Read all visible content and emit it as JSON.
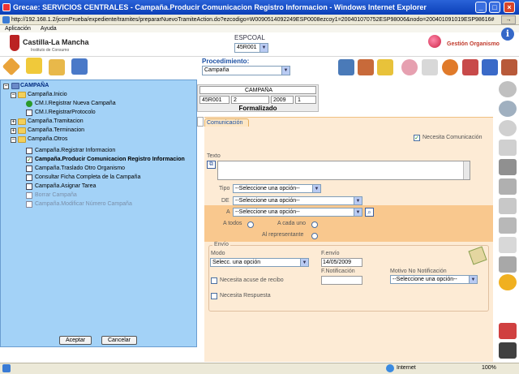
{
  "window": {
    "title": "Grecae: SERVICIOS CENTRALES - Campaña.Producir Comunicacion Registro Informacion - Windows Internet Explorer",
    "url": "http://192.168.1.2/jccmPrueba/expediente/tramites/prepararNuevoTramiteAction.do?ezcodigo=W0090514092249ESP0008ezcoy1=200401070752ESP98006&nodo=200401091019ESP98616#"
  },
  "menu": {
    "items": [
      "Aplicación",
      "Ayuda"
    ]
  },
  "header": {
    "logo": "Castilla-La Mancha",
    "logo_sub": "Instituto de Consumo",
    "espcoal_label": "ESPCOAL",
    "espcoal_value": "45R001",
    "gestion": "Gestión Organismo",
    "procedimiento_label": "Procedimiento:",
    "procedimiento_value": "Campaña"
  },
  "card": {
    "title": "CAMPAÑA",
    "c1": "45R001",
    "c2": "2",
    "c3": "2009",
    "c4": "1",
    "status": "Formalizado"
  },
  "form": {
    "tab": "Comunicación",
    "necesita_comunicacion": "Necesita Comunicación",
    "texto_label": "Texto",
    "tipo_label": "Tipo",
    "de_label": "DE",
    "a_label": "A",
    "select_placeholder": "--Seleccione una opción--",
    "a_todos": "A todos",
    "a_cada_uno": "A cada uno",
    "al_representante": "Al representante",
    "envio_title": "Envío",
    "modo_label": "Modo",
    "modo_value": "Selecc. una opción",
    "fenvio_label": "F.envío",
    "fenvio_value": "14/05/2009",
    "fnotificacion_label": "F.Notificación",
    "acuse_label": "Necesita acuse de recibo",
    "respuesta_label": "Necesita Respuesta",
    "motivo_label": "Motivo No Notificación",
    "motivo_value": "--Seleccione una opción--"
  },
  "tree": {
    "root": "CAMPAÑA",
    "items": [
      "Campaña.Inicio",
      "CM.I.Registrar Nueva Campaña",
      "CM.I.RegistrarProtocolo",
      "Campaña.Tramitacion",
      "Campaña.Terminacion",
      "Campaña.Otros",
      "Campaña.Registrar Informacion",
      "Campaña.Producir Comunicacion Registro Informacion",
      "Campaña.Traslado Otro Organismo",
      "Consultar Ficha Completa de la Campaña",
      "Campaña.Asignar Tarea",
      "Borrar Campaña",
      "Campaña.Modificar Número Campaña"
    ],
    "accept": "Aceptar",
    "cancel": "Cancelar"
  },
  "status": {
    "zone": "Internet",
    "zoom": "100%"
  }
}
